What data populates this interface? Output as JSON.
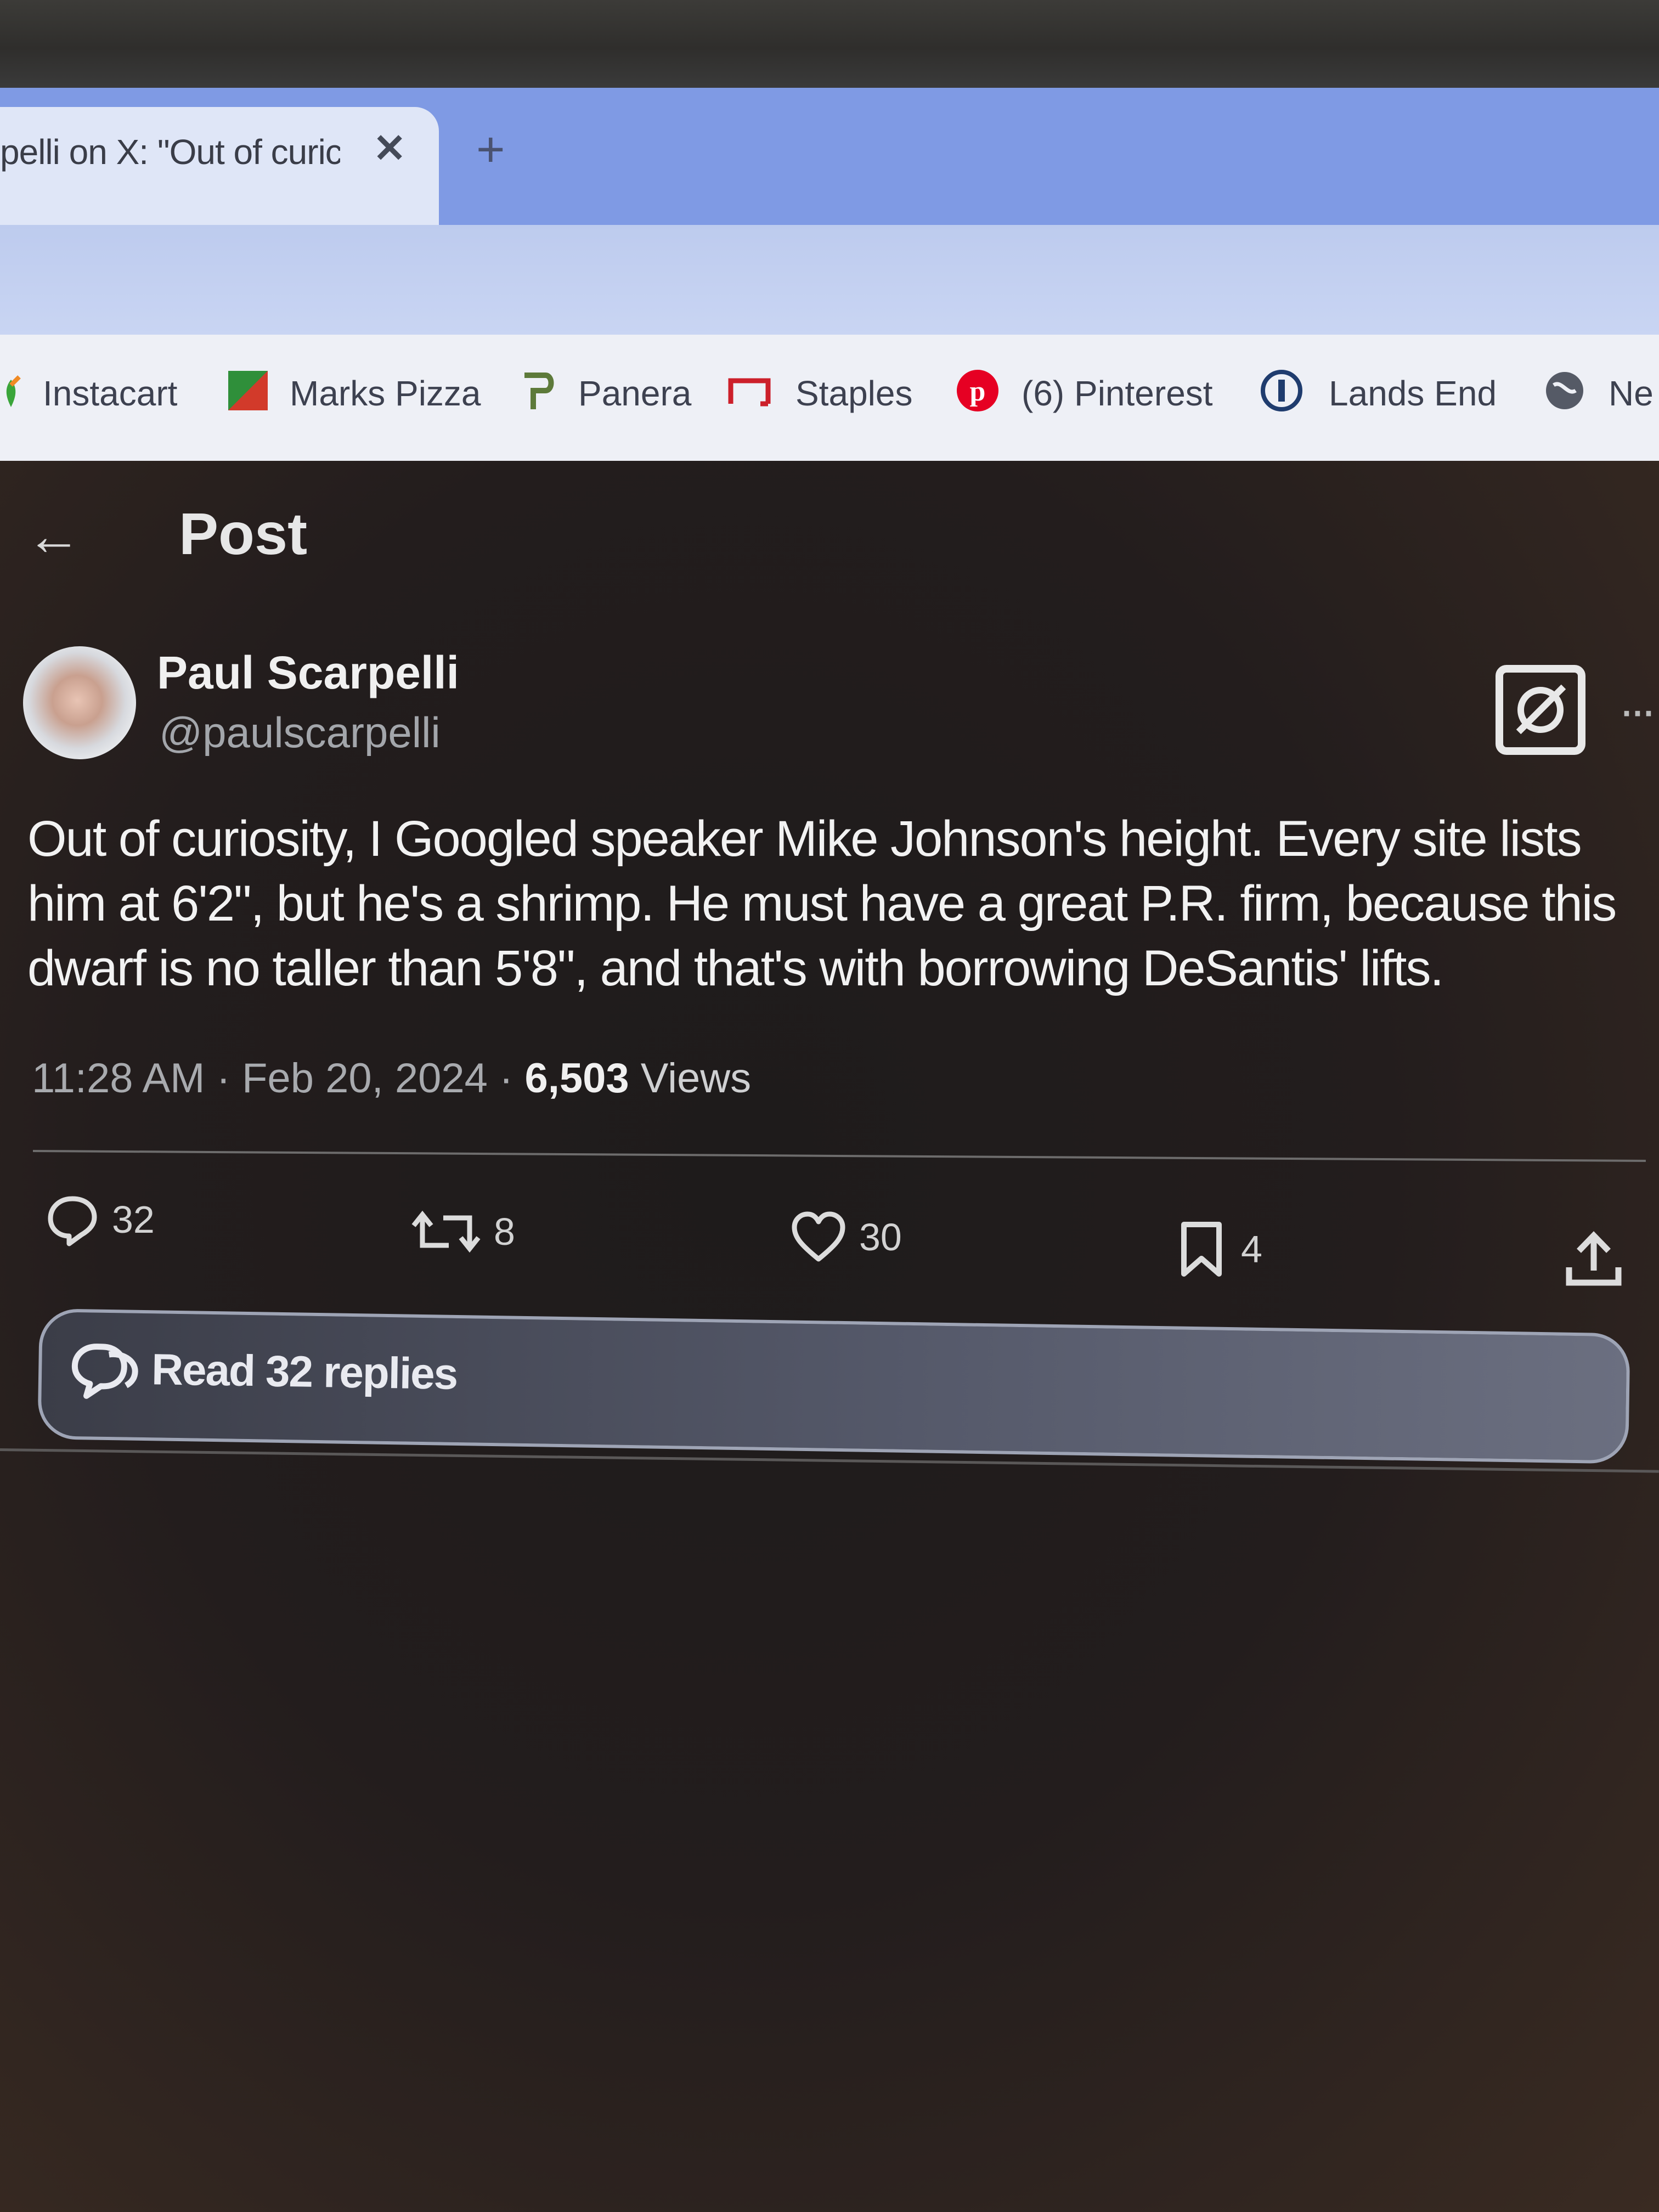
{
  "browser": {
    "tab_title": "pelli on X: \"Out of curic",
    "tab_close": "✕",
    "new_tab": "+",
    "bookmarks": [
      {
        "label": "Instacart",
        "icon": "instacart-icon"
      },
      {
        "label": "Marks Pizza",
        "icon": "marks-pizza-icon"
      },
      {
        "label": "Panera",
        "icon": "panera-icon"
      },
      {
        "label": "Staples",
        "icon": "staples-icon"
      },
      {
        "label": "(6) Pinterest",
        "icon": "pinterest-icon"
      },
      {
        "label": "Lands End",
        "icon": "lands-end-icon"
      },
      {
        "label": "Ne",
        "icon": "globe-icon"
      }
    ]
  },
  "header": {
    "back_icon": "back-arrow-icon",
    "title": "Post"
  },
  "post": {
    "author_name": "Paul Scarpelli",
    "author_handle": "@paulscarpelli",
    "text": "Out of curiosity, I Googled speaker Mike Johnson's height. Every site lists him at 6'2\", but he's a shrimp. He must have a great P.R. firm, because this dwarf is no taller than 5'8\", and that's with borrowing DeSantis' lifts.",
    "time": "11:28 AM · Feb 20, 2024 · ",
    "views_count": "6,503",
    "views_label": " Views",
    "more": "···"
  },
  "actions": {
    "replies": "32",
    "reposts": "8",
    "likes": "30",
    "bookmarks": "4"
  },
  "read_replies": {
    "label": "Read 32 replies"
  },
  "colors": {
    "tabstrip": "#7f9ae4",
    "bookmark_bar": "#eef0f6",
    "page_bg": "#1e1b1b",
    "text": "#f2f2f2",
    "muted": "#a8aaae"
  }
}
